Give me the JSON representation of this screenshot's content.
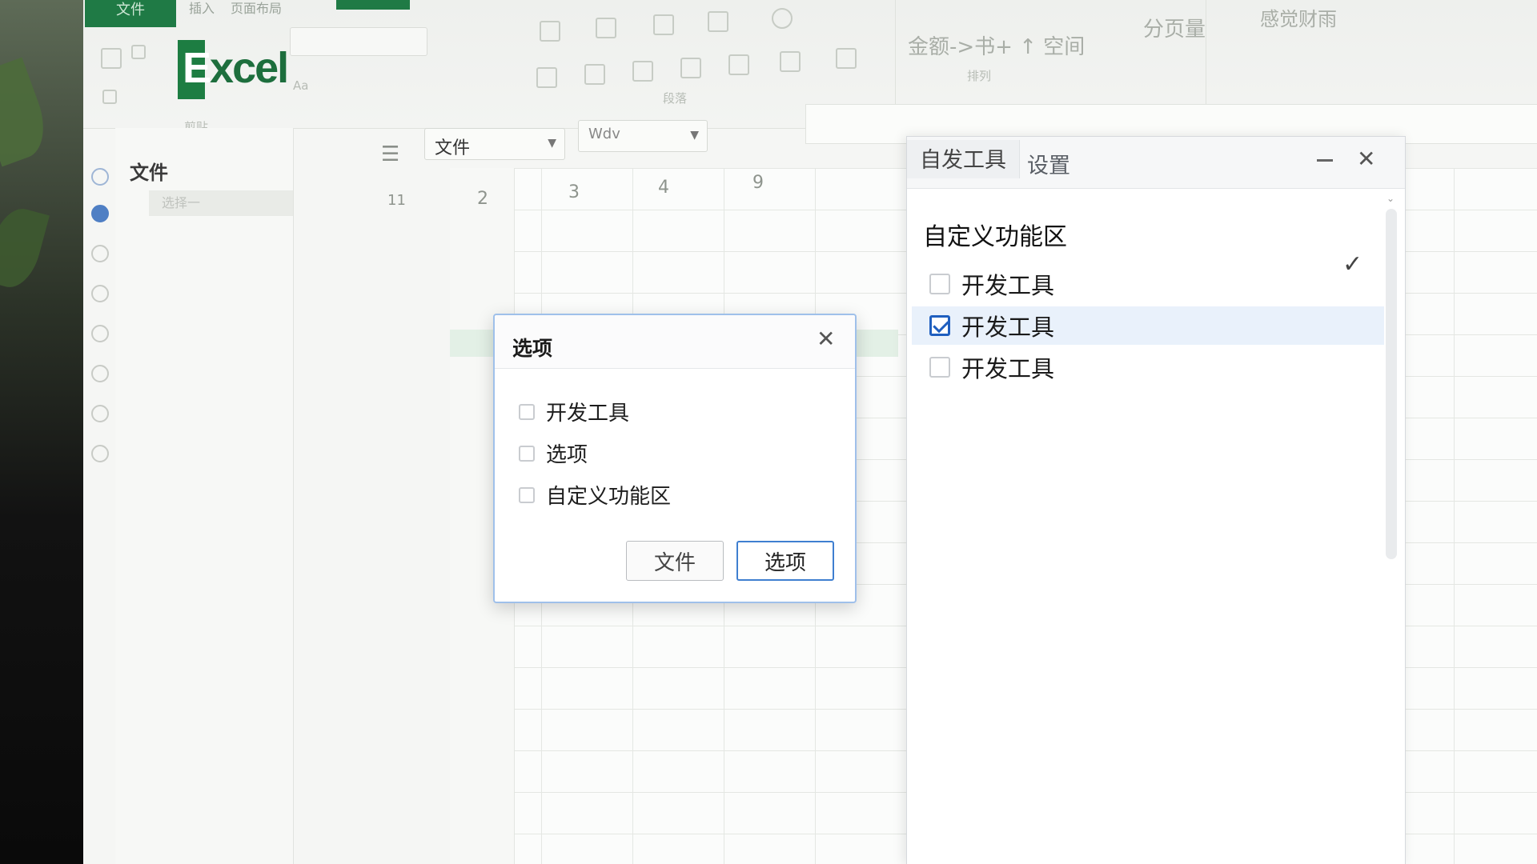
{
  "ribbon": {
    "file_tab": "文件",
    "tabs": [
      "插入",
      "页面布局"
    ],
    "app_logo": "Excel",
    "group_paragraph": "段落",
    "group_arrange": "排列",
    "group_clip": "剪贴",
    "text_spacing": "金额->书+ ↑ 空间",
    "text_split": "分页量",
    "text_right": "感觉财雨",
    "font_hint": "Aa"
  },
  "nav": {
    "header": "文件",
    "item": "选择一"
  },
  "toolbar": {
    "file_combo": "文件",
    "font_combo": "Wdv"
  },
  "sheet": {
    "columns": [
      "2",
      "3",
      "4",
      "9"
    ],
    "right_col": "9",
    "row_marker": "11"
  },
  "dialog": {
    "title": "选项",
    "options": [
      {
        "label": "开发工具",
        "checked": false
      },
      {
        "label": "选项",
        "checked": false
      },
      {
        "label": "自定义功能区",
        "checked": false
      }
    ],
    "btn_secondary": "文件",
    "btn_primary": "选项"
  },
  "panel": {
    "tabs": [
      "自发工具",
      "设置"
    ],
    "section_title": "自定义功能区",
    "items": [
      {
        "label": "开发工具",
        "checked": false
      },
      {
        "label": "开发工具",
        "checked": true
      },
      {
        "label": "开发工具",
        "checked": false
      }
    ]
  },
  "colors": {
    "excel_green": "#1f7a45",
    "accent_blue": "#3f7fd0",
    "selection_blue": "#e9f1fb"
  }
}
